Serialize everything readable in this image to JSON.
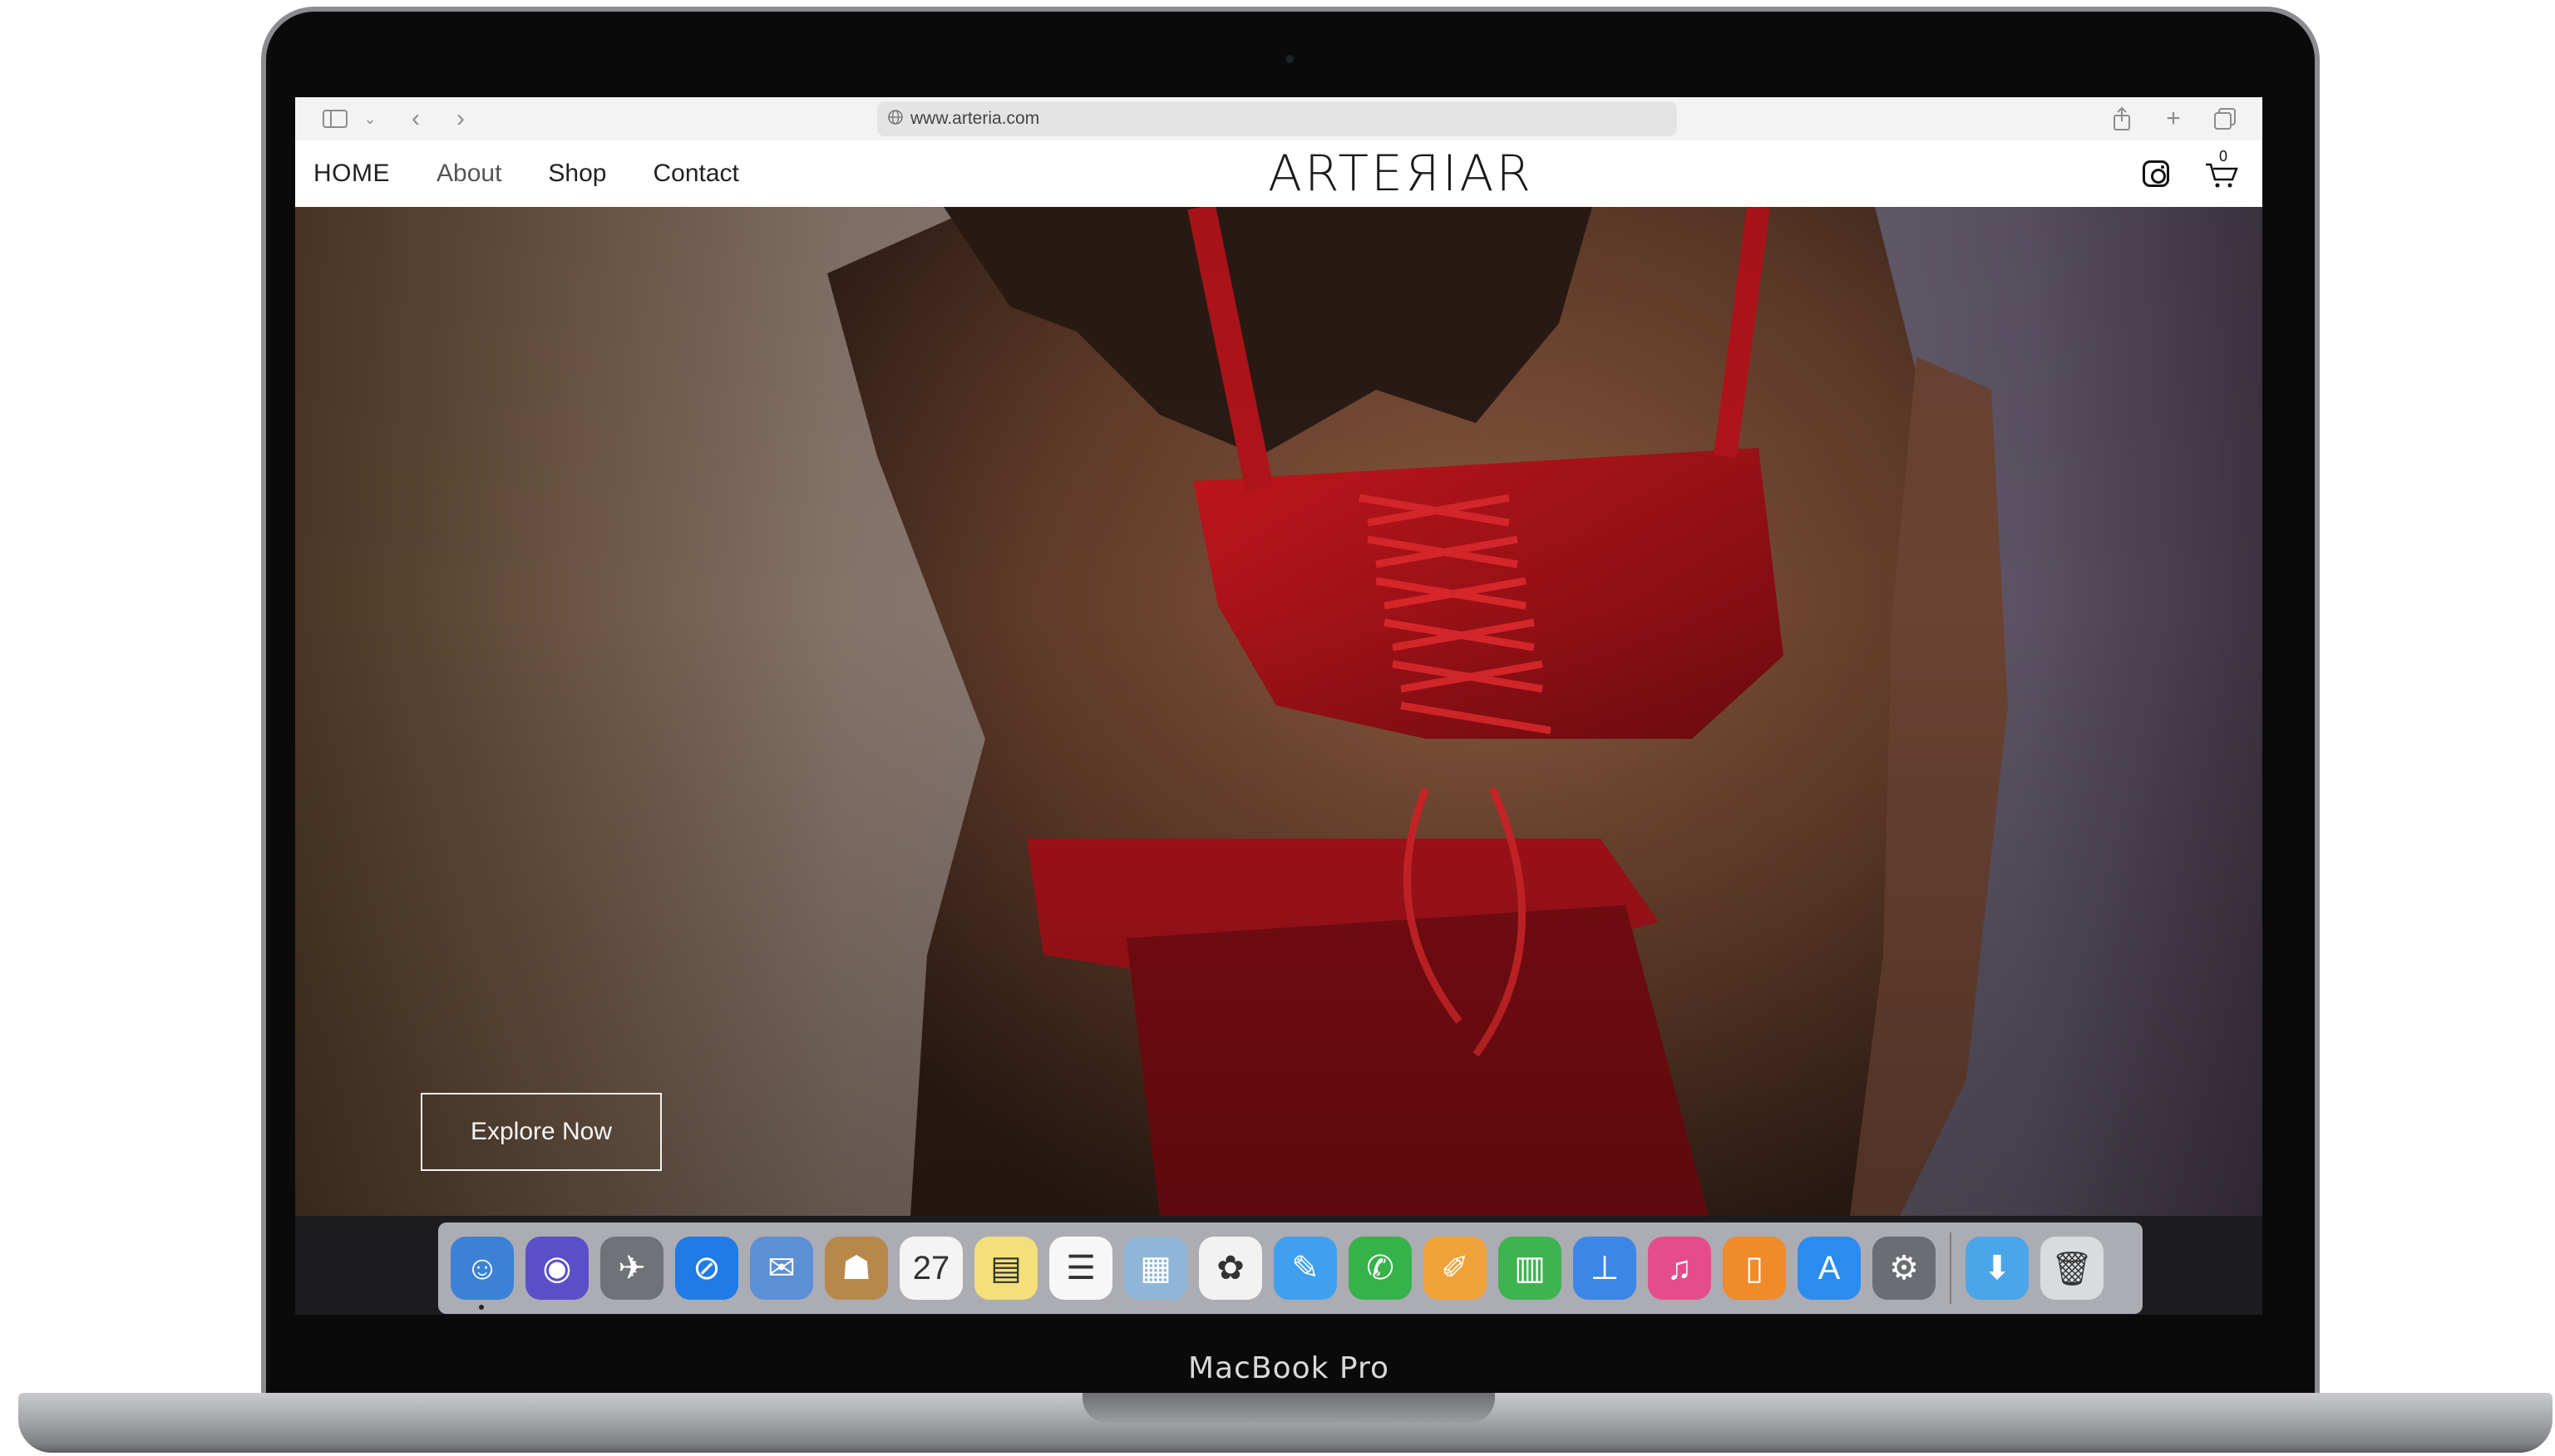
{
  "browser": {
    "url": "www.arteria.com"
  },
  "site": {
    "nav": [
      {
        "label": "HOME"
      },
      {
        "label": "About"
      },
      {
        "label": "Shop"
      },
      {
        "label": "Contact"
      }
    ],
    "logo_text": "ARTEЯIAR",
    "cart_count": "0"
  },
  "hero": {
    "button_label": "Explore Now"
  },
  "device_label": "MacBook Pro",
  "dock": {
    "apps": [
      {
        "name": "finder",
        "glyph": "☺",
        "color": "#3b82d6"
      },
      {
        "name": "siri",
        "glyph": "◉",
        "color": "#5a4fc9"
      },
      {
        "name": "launchpad",
        "glyph": "✈",
        "color": "#6f7378"
      },
      {
        "name": "safari",
        "glyph": "⊘",
        "color": "#1f7be6"
      },
      {
        "name": "mail",
        "glyph": "✉",
        "color": "#5b8fd6"
      },
      {
        "name": "contacts",
        "glyph": "☗",
        "color": "#b8874a"
      },
      {
        "name": "calendar",
        "glyph": "27",
        "color": "#f4f4f4"
      },
      {
        "name": "notes",
        "glyph": "▤",
        "color": "#f3e07a"
      },
      {
        "name": "reminders",
        "glyph": "☰",
        "color": "#f7f7f7"
      },
      {
        "name": "preview",
        "glyph": "▦",
        "color": "#8fb6d8"
      },
      {
        "name": "photos",
        "glyph": "✿",
        "color": "#f2f2f2"
      },
      {
        "name": "messages",
        "glyph": "✎",
        "color": "#3fa0ef"
      },
      {
        "name": "facetime",
        "glyph": "✆",
        "color": "#36b24a"
      },
      {
        "name": "pages",
        "glyph": "✐",
        "color": "#f0a23a"
      },
      {
        "name": "numbers",
        "glyph": "▥",
        "color": "#3fb34f"
      },
      {
        "name": "keynote",
        "glyph": "⊥",
        "color": "#3c86e6"
      },
      {
        "name": "itunes",
        "glyph": "♫",
        "color": "#e54c8c"
      },
      {
        "name": "ibooks",
        "glyph": "▯",
        "color": "#f08a2a"
      },
      {
        "name": "app-store",
        "glyph": "A",
        "color": "#2a8cef"
      },
      {
        "name": "system-preferences",
        "glyph": "⚙",
        "color": "#6a6d72"
      }
    ],
    "trailing": [
      {
        "name": "downloads-folder",
        "glyph": "⬇",
        "color": "#4aa6e8"
      },
      {
        "name": "trash",
        "glyph": "🗑",
        "color": "#d9dcdf"
      }
    ]
  }
}
